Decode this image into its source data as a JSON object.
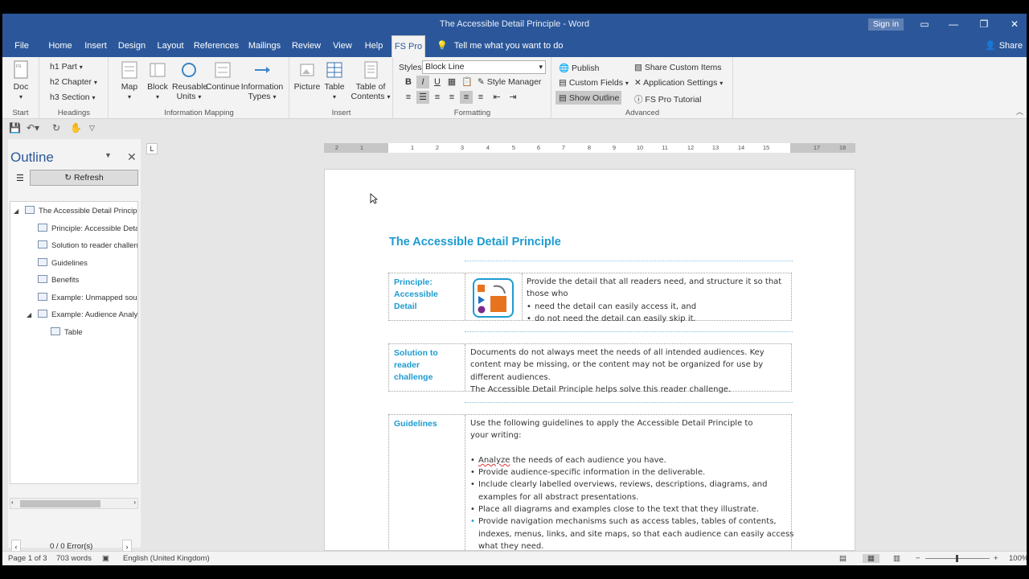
{
  "window": {
    "title": "The Accessible Detail Principle  -  Word",
    "sign_in": "Sign in",
    "share": "Share",
    "tell_me": "Tell me what you want to do"
  },
  "tabs": [
    "File",
    "Home",
    "Insert",
    "Design",
    "Layout",
    "References",
    "Mailings",
    "Review",
    "View",
    "Help",
    "FS Pro"
  ],
  "active_tab": "FS Pro",
  "ribbon": {
    "start": {
      "label": "Start",
      "doc": "Doc"
    },
    "headings": {
      "label": "Headings",
      "h1": "h1  Part",
      "h2": "h2  Chapter",
      "h3": "h3  Section"
    },
    "info_mapping": {
      "label": "Information Mapping",
      "map": "Map",
      "block": "Block",
      "reusable1": "Reusable",
      "reusable2": "Units",
      "continue": "Continue",
      "info1": "Information",
      "info2": "Types"
    },
    "insert": {
      "label": "Insert",
      "picture": "Picture",
      "table": "Table",
      "toc1": "Table of",
      "toc2": "Contents"
    },
    "formatting": {
      "label": "Formatting",
      "styles_label": "Styles",
      "styles_value": "Block Line",
      "style_manager": "Style Manager"
    },
    "advanced": {
      "label": "Advanced",
      "publish": "Publish",
      "custom_fields": "Custom Fields",
      "show_outline": "Show Outline",
      "share_custom": "Share Custom Items",
      "app_settings": "Application Settings",
      "tutorial": "FS Pro Tutorial"
    }
  },
  "outline": {
    "title": "Outline",
    "refresh": "Refresh",
    "nodes": [
      "The Accessible Detail Principle",
      "Principle: Accessible Detail",
      "Solution to reader challenge",
      "Guidelines",
      "Benefits",
      "Example: Unmapped source",
      "Example: Audience Analysis",
      "Table"
    ],
    "errors": "0 / 0  Error(s)"
  },
  "document": {
    "title": "The Accessible Detail Principle",
    "principle": {
      "label": "Principle: Accessible Detail",
      "line1": "Provide the detail that all readers need, and structure it so that",
      "line2": "those who",
      "bullet1": "need the detail can easily access it, and",
      "bullet2": "do not need the detail can easily skip it."
    },
    "solution": {
      "label": "Solution to reader challenge",
      "line1": "Documents do not always meet the needs of all intended audiences. Key",
      "line2": "content may be missing, or the content may not be organized for use by",
      "line3": "different audiences.",
      "line4": "The Accessible Detail Principle helps solve this reader challenge."
    },
    "guidelines": {
      "label": "Guidelines",
      "intro1": "Use the following guidelines to apply the Accessible Detail Principle to",
      "intro2": "your writing:",
      "b1a": "Analyze",
      "b1b": " the needs of each audience you have.",
      "b2": "Provide audience-specific information in the deliverable.",
      "b3a": "Include clearly labelled overviews, reviews, descriptions, diagrams, and",
      "b3b": "examples for all abstract presentations.",
      "b4": "Place all diagrams and examples close to the text that they illustrate.",
      "b5a": "Provide navigation mechanisms such as access tables, tables of contents,",
      "b5b": "indexes, menus, links, and site maps, so that each audience can easily access",
      "b5c": "what they need."
    }
  },
  "status": {
    "page": "Page 1 of 3",
    "words": "703 words",
    "language": "English (United Kingdom)",
    "zoom": "100%"
  },
  "ruler_labels": [
    "2",
    "1",
    "1",
    "2",
    "3",
    "4",
    "5",
    "6",
    "7",
    "8",
    "9",
    "10",
    "11",
    "12",
    "13",
    "14",
    "15",
    "17",
    "18"
  ],
  "colors": {
    "brand": "#2b579a",
    "heading": "#1c9bd2"
  }
}
